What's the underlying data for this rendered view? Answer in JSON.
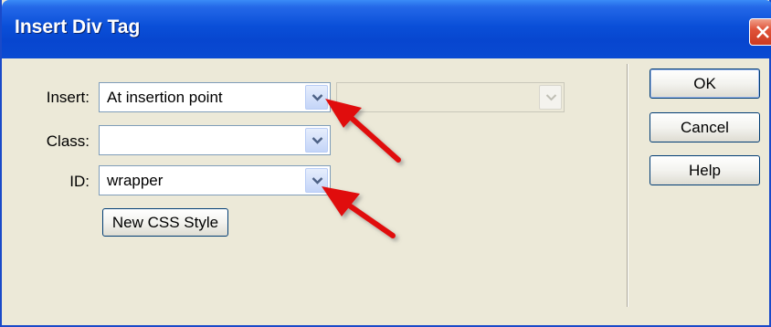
{
  "window": {
    "title": "Insert Div Tag"
  },
  "form": {
    "insert": {
      "label": "Insert:",
      "value": "At insertion point",
      "secondary_value": ""
    },
    "class": {
      "label": "Class:",
      "value": ""
    },
    "id": {
      "label": "ID:",
      "value": "wrapper"
    },
    "new_css_style_label": "New CSS Style"
  },
  "buttons": {
    "ok": "OK",
    "cancel": "Cancel",
    "help": "Help"
  },
  "colors": {
    "titlebar": "#0a4fd8",
    "dialog_bg": "#ece9d8",
    "annotation_arrow": "#e01010",
    "close": "#e0543a"
  },
  "icons": {
    "close": "close-icon",
    "dropdown": "chevron-down-icon",
    "annotation": "red-arrow-icon"
  }
}
